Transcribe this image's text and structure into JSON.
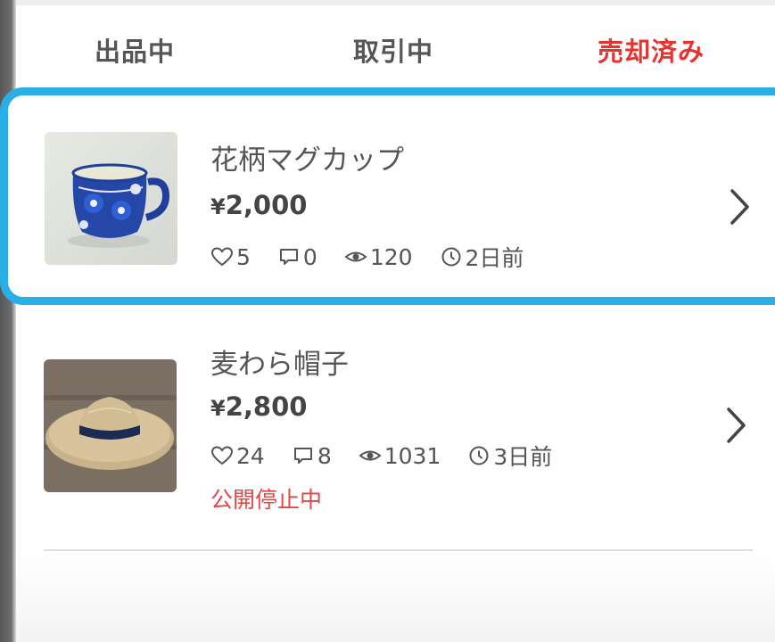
{
  "tabs": [
    {
      "label": "出品中"
    },
    {
      "label": "取引中"
    },
    {
      "label": "売却済み"
    }
  ],
  "active_tab": "売却済み",
  "accent_colors": {
    "active_tab": "#e8322f",
    "highlight": "#2aaee6",
    "status": "#e04848"
  },
  "items": [
    {
      "title": "花柄マグカップ",
      "currency": "¥",
      "price": "2,000",
      "likes": "5",
      "comments": "0",
      "views": "120",
      "posted": "2日前",
      "thumbnail": "mug-photo"
    },
    {
      "title": "麦わら帽子",
      "currency": "¥",
      "price": "2,800",
      "likes": "24",
      "comments": "8",
      "views": "1031",
      "posted": "3日前",
      "status": "公開停止中",
      "thumbnail": "straw-hat-photo"
    }
  ],
  "icons": [
    "heart-icon",
    "comment-icon",
    "eye-icon",
    "clock-icon",
    "chevron-right-icon"
  ]
}
